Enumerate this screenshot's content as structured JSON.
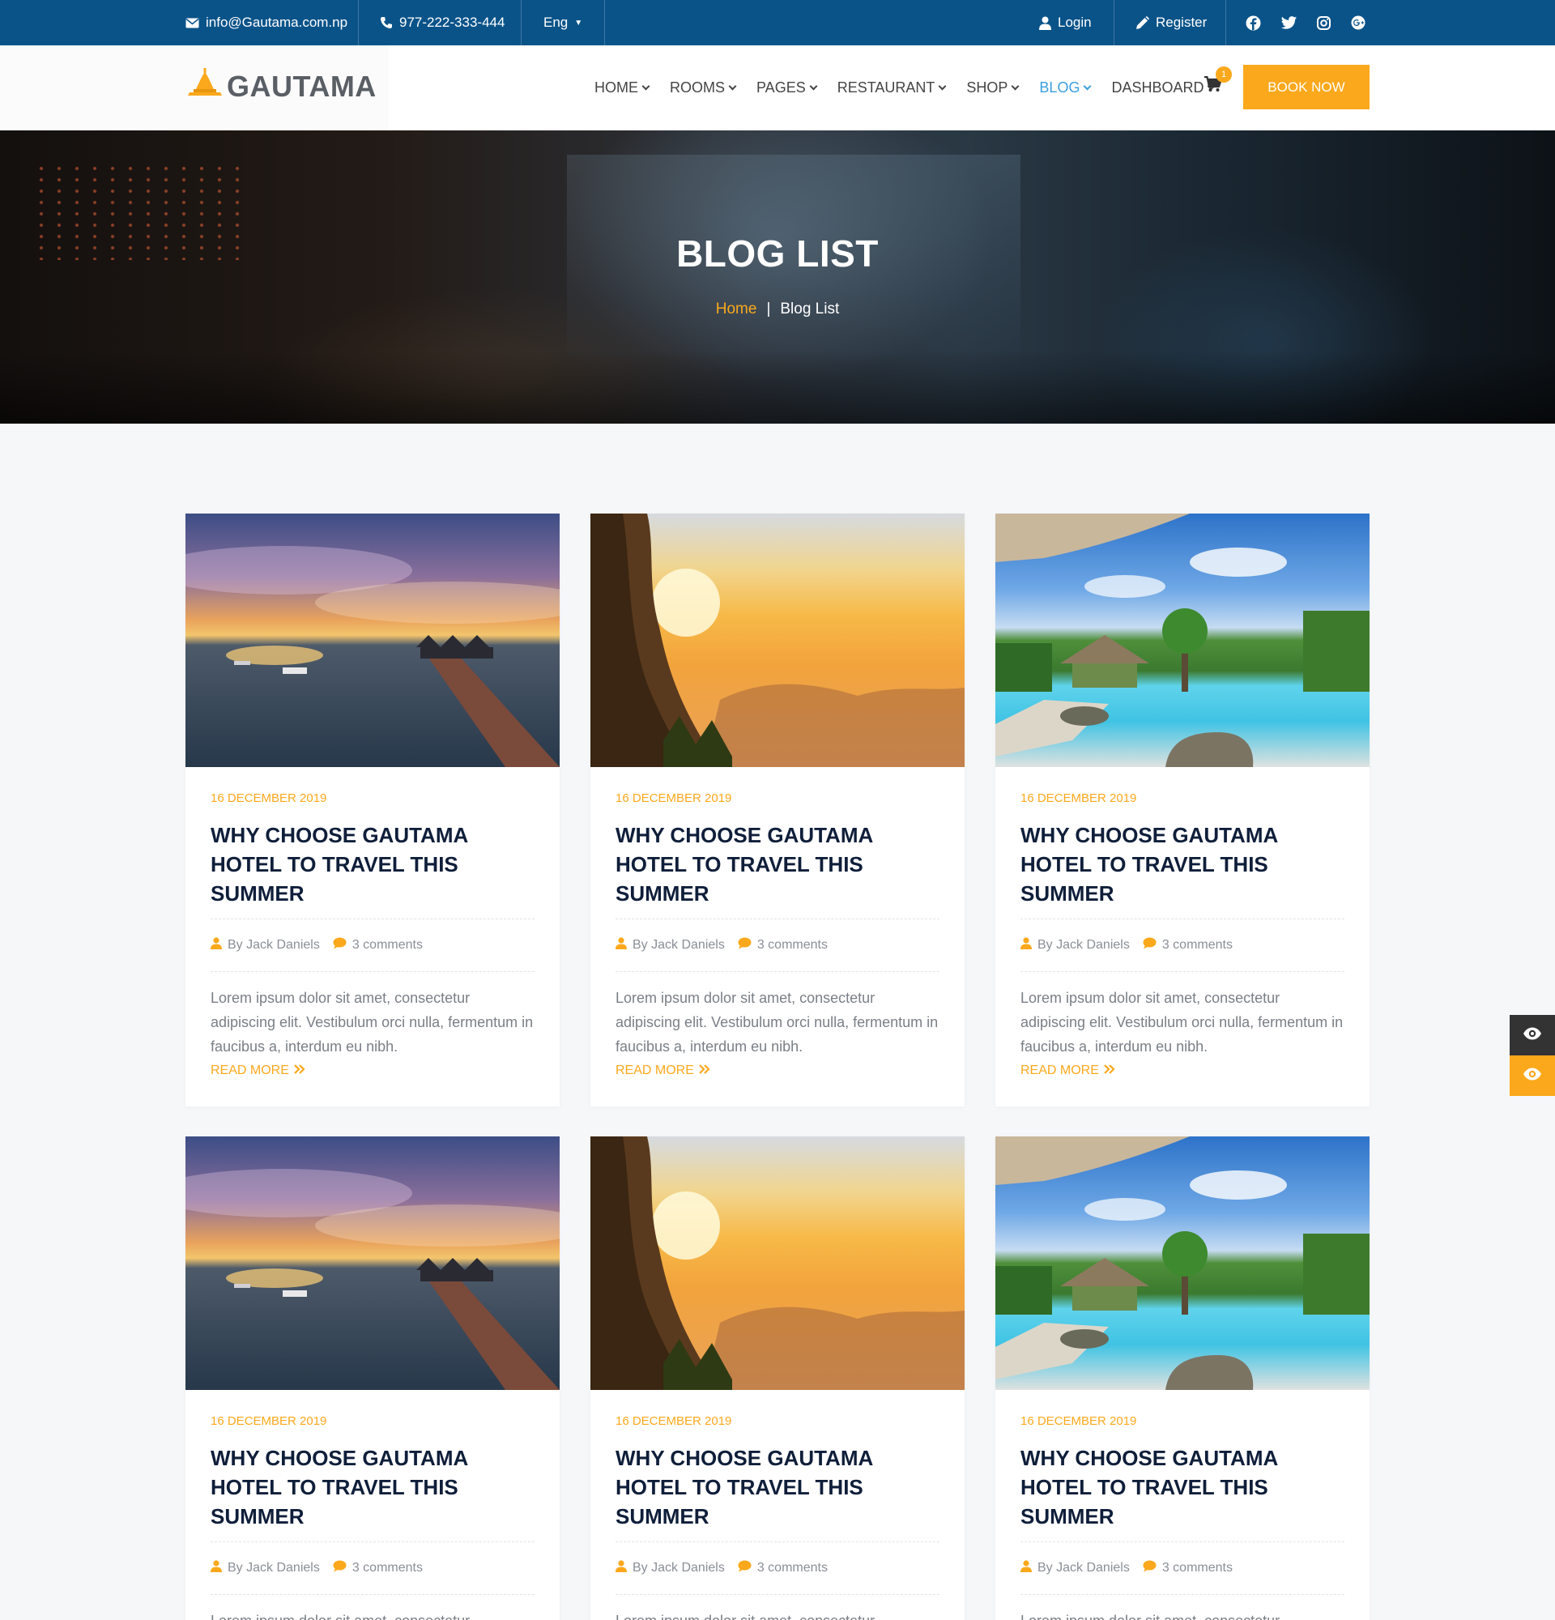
{
  "topbar": {
    "email": "info@Gautama.com.np",
    "phone": "977-222-333-444",
    "language": "Eng",
    "login": "Login",
    "register": "Register",
    "social_icons": [
      "facebook-icon",
      "twitter-icon",
      "instagram-icon",
      "google-plus-icon"
    ]
  },
  "header": {
    "logo_text": "GAUTAMA",
    "nav": [
      {
        "label": "HOME"
      },
      {
        "label": "ROOMS"
      },
      {
        "label": "PAGES"
      },
      {
        "label": "RESTAURANT"
      },
      {
        "label": "SHOP"
      },
      {
        "label": "BLOG",
        "active": true
      },
      {
        "label": "DASHBOARD"
      }
    ],
    "cart_count": "1",
    "book_now": "BOOK NOW"
  },
  "hero": {
    "title": "BLOG LIST",
    "breadcrumb_home": "Home",
    "breadcrumb_sep": "|",
    "breadcrumb_current": "Blog List"
  },
  "colors": {
    "topbar": "#0a5389",
    "accent": "#fba81c",
    "heading": "#0f1e3a",
    "nav_active": "#3a9fe0"
  },
  "posts": [
    {
      "image": "pier-sunset",
      "date": "16 DECEMBER 2019",
      "title": "WHY CHOOSE GAUTAMA HOTEL TO TRAVEL THIS SUMMER",
      "author": "By Jack Daniels",
      "comments": "3 comments",
      "excerpt": "Lorem ipsum dolor sit amet, consectetur adipiscing elit. Vestibulum orci nulla, fermentum in faucibus a, interdum eu nibh.",
      "read_more": "READ MORE"
    },
    {
      "image": "cliff-sunrise",
      "date": "16 DECEMBER 2019",
      "title": "WHY CHOOSE GAUTAMA HOTEL TO TRAVEL THIS SUMMER",
      "author": "By Jack Daniels",
      "comments": "3 comments",
      "excerpt": "Lorem ipsum dolor sit amet, consectetur adipiscing elit. Vestibulum orci nulla, fermentum in faucibus a, interdum eu nibh.",
      "read_more": "READ MORE"
    },
    {
      "image": "resort-pool",
      "date": "16 DECEMBER 2019",
      "title": "WHY CHOOSE GAUTAMA HOTEL TO TRAVEL THIS SUMMER",
      "author": "By Jack Daniels",
      "comments": "3 comments",
      "excerpt": "Lorem ipsum dolor sit amet, consectetur adipiscing elit. Vestibulum orci nulla, fermentum in faucibus a, interdum eu nibh.",
      "read_more": "READ MORE"
    },
    {
      "image": "pier-sunset",
      "date": "16 DECEMBER 2019",
      "title": "WHY CHOOSE GAUTAMA HOTEL TO TRAVEL THIS SUMMER",
      "author": "By Jack Daniels",
      "comments": "3 comments",
      "excerpt": "Lorem ipsum dolor sit amet, consectetur",
      "read_more": ""
    },
    {
      "image": "cliff-sunrise",
      "date": "16 DECEMBER 2019",
      "title": "WHY CHOOSE GAUTAMA HOTEL TO TRAVEL THIS SUMMER",
      "author": "By Jack Daniels",
      "comments": "3 comments",
      "excerpt": "Lorem ipsum dolor sit amet, consectetur",
      "read_more": ""
    },
    {
      "image": "resort-pool",
      "date": "16 DECEMBER 2019",
      "title": "WHY CHOOSE GAUTAMA HOTEL TO TRAVEL THIS SUMMER",
      "author": "By Jack Daniels",
      "comments": "3 comments",
      "excerpt": "Lorem ipsum dolor sit amet, consectetur",
      "read_more": ""
    }
  ],
  "side_widgets": [
    "eye-icon",
    "eye-icon"
  ]
}
